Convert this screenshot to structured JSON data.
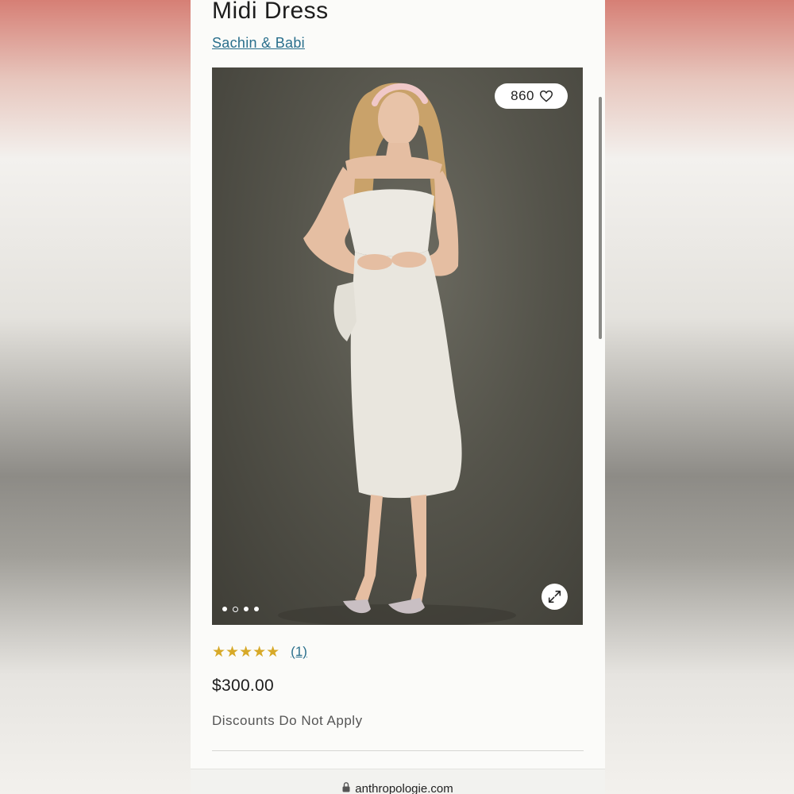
{
  "product": {
    "title": "Midi Dress",
    "brand": "Sachin & Babi",
    "likes": "860",
    "rating_stars": "★★★★★",
    "rating": 5,
    "review_count": "(1)",
    "price": "$300.00",
    "discount_note": "Discounts Do Not Apply"
  },
  "gallery": {
    "image_count": 4,
    "active_index": 1
  },
  "browser": {
    "url": "anthropologie.com"
  },
  "colors": {
    "link": "#2a6f8c",
    "star": "#d7a928"
  }
}
